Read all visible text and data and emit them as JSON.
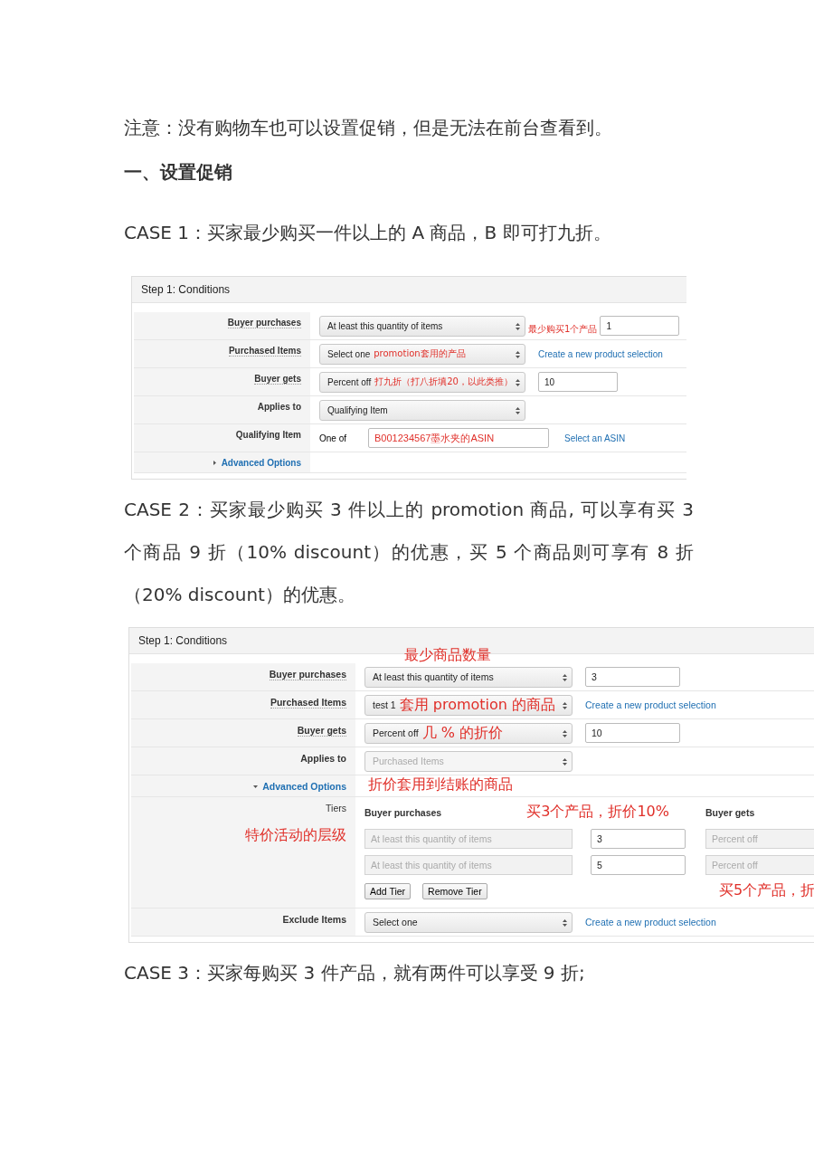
{
  "paragraphs": [
    {
      "kind": "text",
      "text": "注意：没有购物车也可以设置促销，但是无法在前台查看到。"
    },
    {
      "kind": "heading",
      "text": "一、设置促销"
    },
    {
      "kind": "text",
      "text": "CASE 1：买家最少购买一件以上的 A 商品，B 即可打九折。"
    }
  ],
  "panel_1": {
    "header": "Step 1: Conditions",
    "rows": [
      {
        "kind": "field",
        "label": "Buyer purchases",
        "underlined": true,
        "select": {
          "text": "At least this quantity of items",
          "disabled": false
        },
        "note": {
          "text": "最少购买1个产品",
          "kind": "edge"
        },
        "input": "1"
      },
      {
        "kind": "field",
        "label": "Purchased Items",
        "underlined": true,
        "select": {
          "text": "Select one",
          "disabled": false
        },
        "note": {
          "text": "promotion套用的产品",
          "kind": "inside"
        },
        "link": "Create a new product selection"
      },
      {
        "kind": "field",
        "label": "Buyer gets",
        "underlined": true,
        "select": {
          "text": "Percent off",
          "disabled": false
        },
        "note": {
          "text": "打九折（打八折填20，以此类推）",
          "kind": "inside"
        },
        "input": "10"
      },
      {
        "kind": "field",
        "label": "Applies to",
        "underlined": false,
        "select": {
          "text": "Qualifying Item",
          "disabled": false
        }
      },
      {
        "kind": "asin",
        "label": "Qualifying Item",
        "underlined": false,
        "prefix": "One of",
        "input": "B001234567墨水夹的ASIN",
        "link": "Select an ASIN"
      },
      {
        "kind": "expander",
        "label": "Advanced Options",
        "expanded": false
      }
    ]
  },
  "paragraphs_2": [
    {
      "kind": "text",
      "text": "CASE 2：买家最少购买 3 件以上的 promotion 商品, 可以享有买 3 个商品 9 折（10% discount）的优惠，买 5 个商品则可享有 8 折（20% discount）的优惠。"
    }
  ],
  "panel_2": {
    "header": "Step 1: Conditions",
    "rows": [
      {
        "kind": "field",
        "label": "Buyer purchases",
        "underlined": true,
        "select": {
          "text": "At least this quantity of items",
          "disabled": false
        },
        "note": {
          "text": "最少商品数量",
          "kind": "above"
        },
        "input": "3"
      },
      {
        "kind": "field",
        "label": "Purchased Items",
        "underlined": true,
        "select": {
          "text": "test 1",
          "disabled": false
        },
        "note": {
          "text": "套用 promotion 的商品",
          "kind": "inside"
        },
        "link": "Create a new product selection"
      },
      {
        "kind": "field",
        "label": "Buyer gets",
        "underlined": true,
        "select": {
          "text": "Percent off",
          "disabled": false
        },
        "note": {
          "text": "几 % 的折价",
          "kind": "inside"
        },
        "input": "10"
      },
      {
        "kind": "field",
        "label": "Applies to",
        "underlined": false,
        "select": {
          "text": "Purchased Items",
          "disabled": true
        },
        "note": {
          "text": "折价套用到结账的商品",
          "kind": "below"
        }
      },
      {
        "kind": "expander",
        "label": "Advanced Options",
        "expanded": true
      },
      {
        "kind": "tiers",
        "label": "Tiers",
        "label_note": "特价活动的层级",
        "headings": [
          "Buyer purchases",
          "Buyer gets"
        ],
        "note_top": "买3个产品，折价10%",
        "tiers": [
          {
            "select": "At least this quantity of items",
            "input": "3",
            "gets": "Percent off"
          },
          {
            "select": "At least this quantity of items",
            "input": "5",
            "gets": "Percent off"
          }
        ],
        "buttons": [
          "Add Tier",
          "Remove Tier"
        ],
        "note_bottom": "买5个产品，折"
      },
      {
        "kind": "field",
        "label": "Exclude Items",
        "underlined": false,
        "select": {
          "text": "Select one",
          "disabled": false
        },
        "link": "Create a new product selection"
      }
    ]
  },
  "paragraphs_3": [
    {
      "kind": "text",
      "text": "CASE 3：买家每购买 3 件产品，就有两件可以享受 9 折;"
    }
  ]
}
